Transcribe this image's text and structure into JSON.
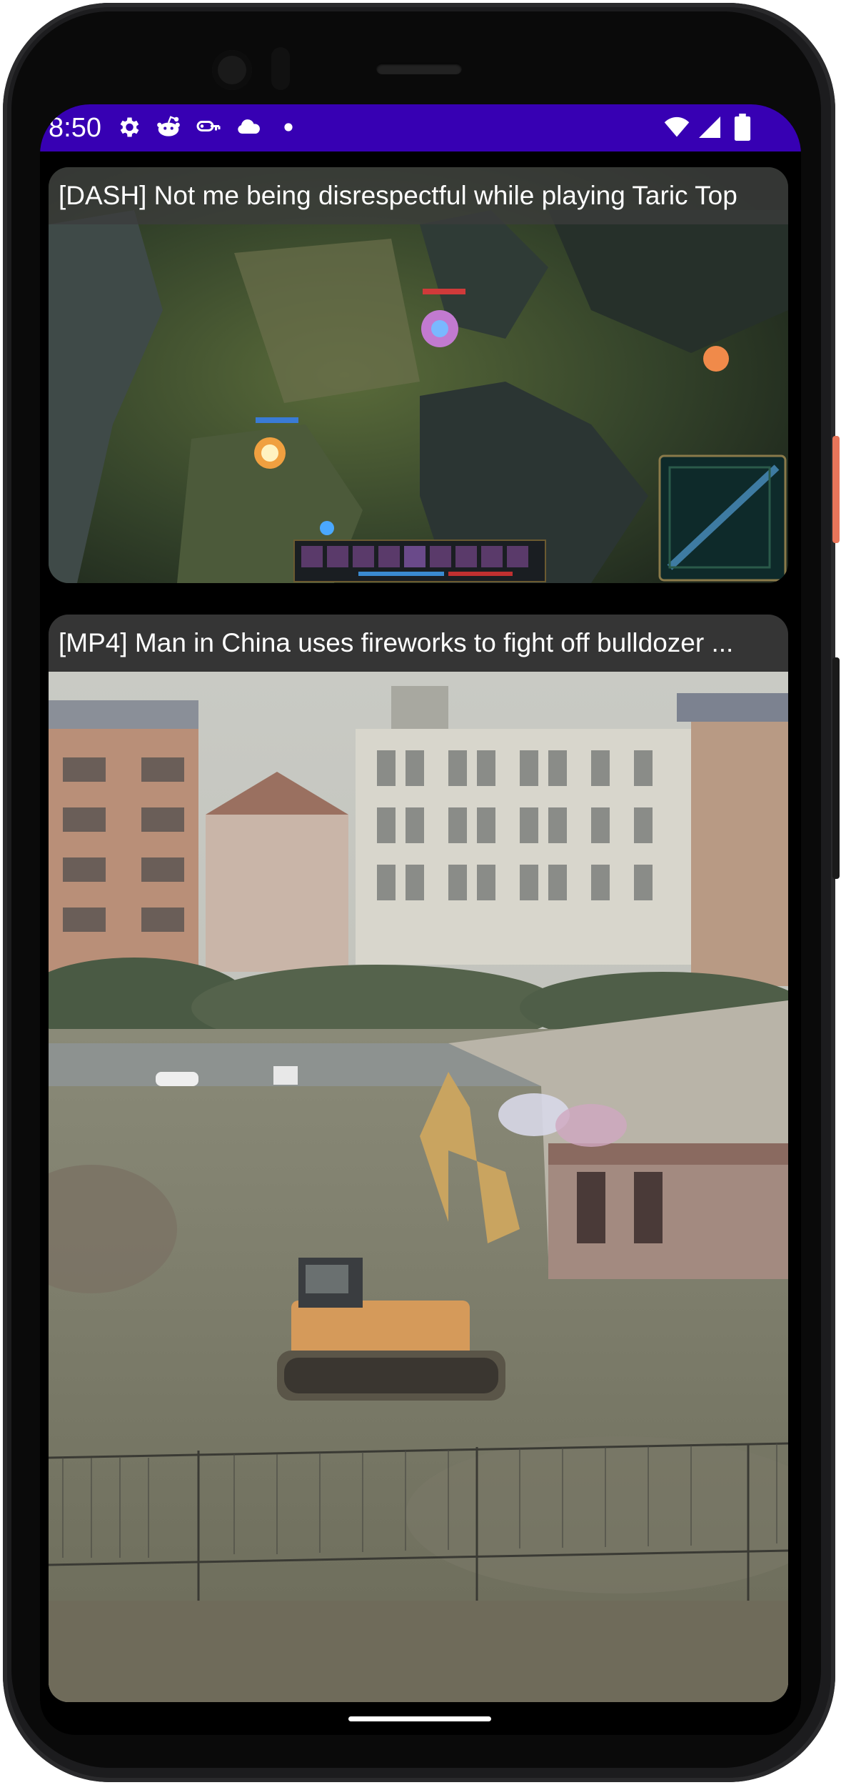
{
  "status_bar": {
    "time": "8:50",
    "left_icons": [
      "gear-icon",
      "reddit-icon",
      "vpn-key-icon",
      "cloud-icon",
      "dot-icon"
    ],
    "right_icons": [
      "wifi-icon",
      "signal-icon",
      "battery-icon"
    ],
    "color": "#3700b3"
  },
  "videos": [
    {
      "title": "[DASH] Not me being disrespectful while playing Taric Top",
      "thumbnail": "league-of-legends-gameplay"
    },
    {
      "title": "[MP4] Man in China uses fireworks to fight off bulldozer ...",
      "thumbnail": "excavator-near-buildings"
    }
  ]
}
